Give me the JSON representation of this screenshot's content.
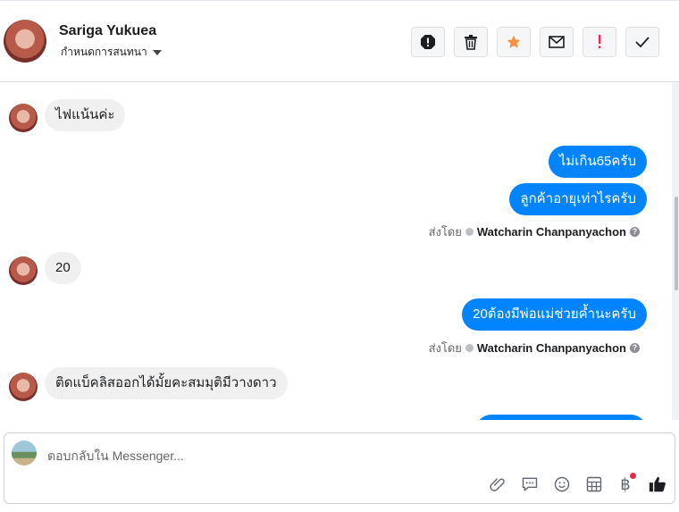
{
  "header": {
    "name": "Sariga Yukuea",
    "subtitle": "กำหนดการสนทนา",
    "actions": [
      "spam-icon",
      "trash-icon",
      "star-icon",
      "envelope-icon",
      "exclamation-icon",
      "check-icon"
    ]
  },
  "messages": [
    {
      "dir": "in",
      "text": "ไฟแน้นค่ะ"
    },
    {
      "dir": "out",
      "text": "ไม่เกิน65ครับ"
    },
    {
      "dir": "out",
      "text": "ลูกค้าอายุเท่าไรครับ"
    },
    {
      "dir": "meta",
      "prefix": "ส่งโดย",
      "author": "Watcharin Chanpanyachon"
    },
    {
      "dir": "in",
      "text": "20"
    },
    {
      "dir": "out",
      "text": "20ต้องมีพ่อแม่ช่วยค้ำนะครับ"
    },
    {
      "dir": "meta",
      "prefix": "ส่งโดย",
      "author": "Watcharin Chanpanyachon"
    },
    {
      "dir": "in",
      "text": "ติดแบ็คลิสออกได้มั้ยคะสมมุติมีวางดาว"
    }
  ],
  "composer": {
    "placeholder": "ตอบกลับใน Messenger...",
    "tools": [
      "paperclip-icon",
      "speech-bubble-icon",
      "emoji-icon",
      "template-icon",
      "baht-icon",
      "thumbs-up-icon"
    ],
    "baht_symbol": "฿"
  },
  "colors": {
    "accent": "#0084ff",
    "incoming_bubble": "#f0f0f0",
    "star": "#f7923a",
    "alert": "#f02849"
  }
}
